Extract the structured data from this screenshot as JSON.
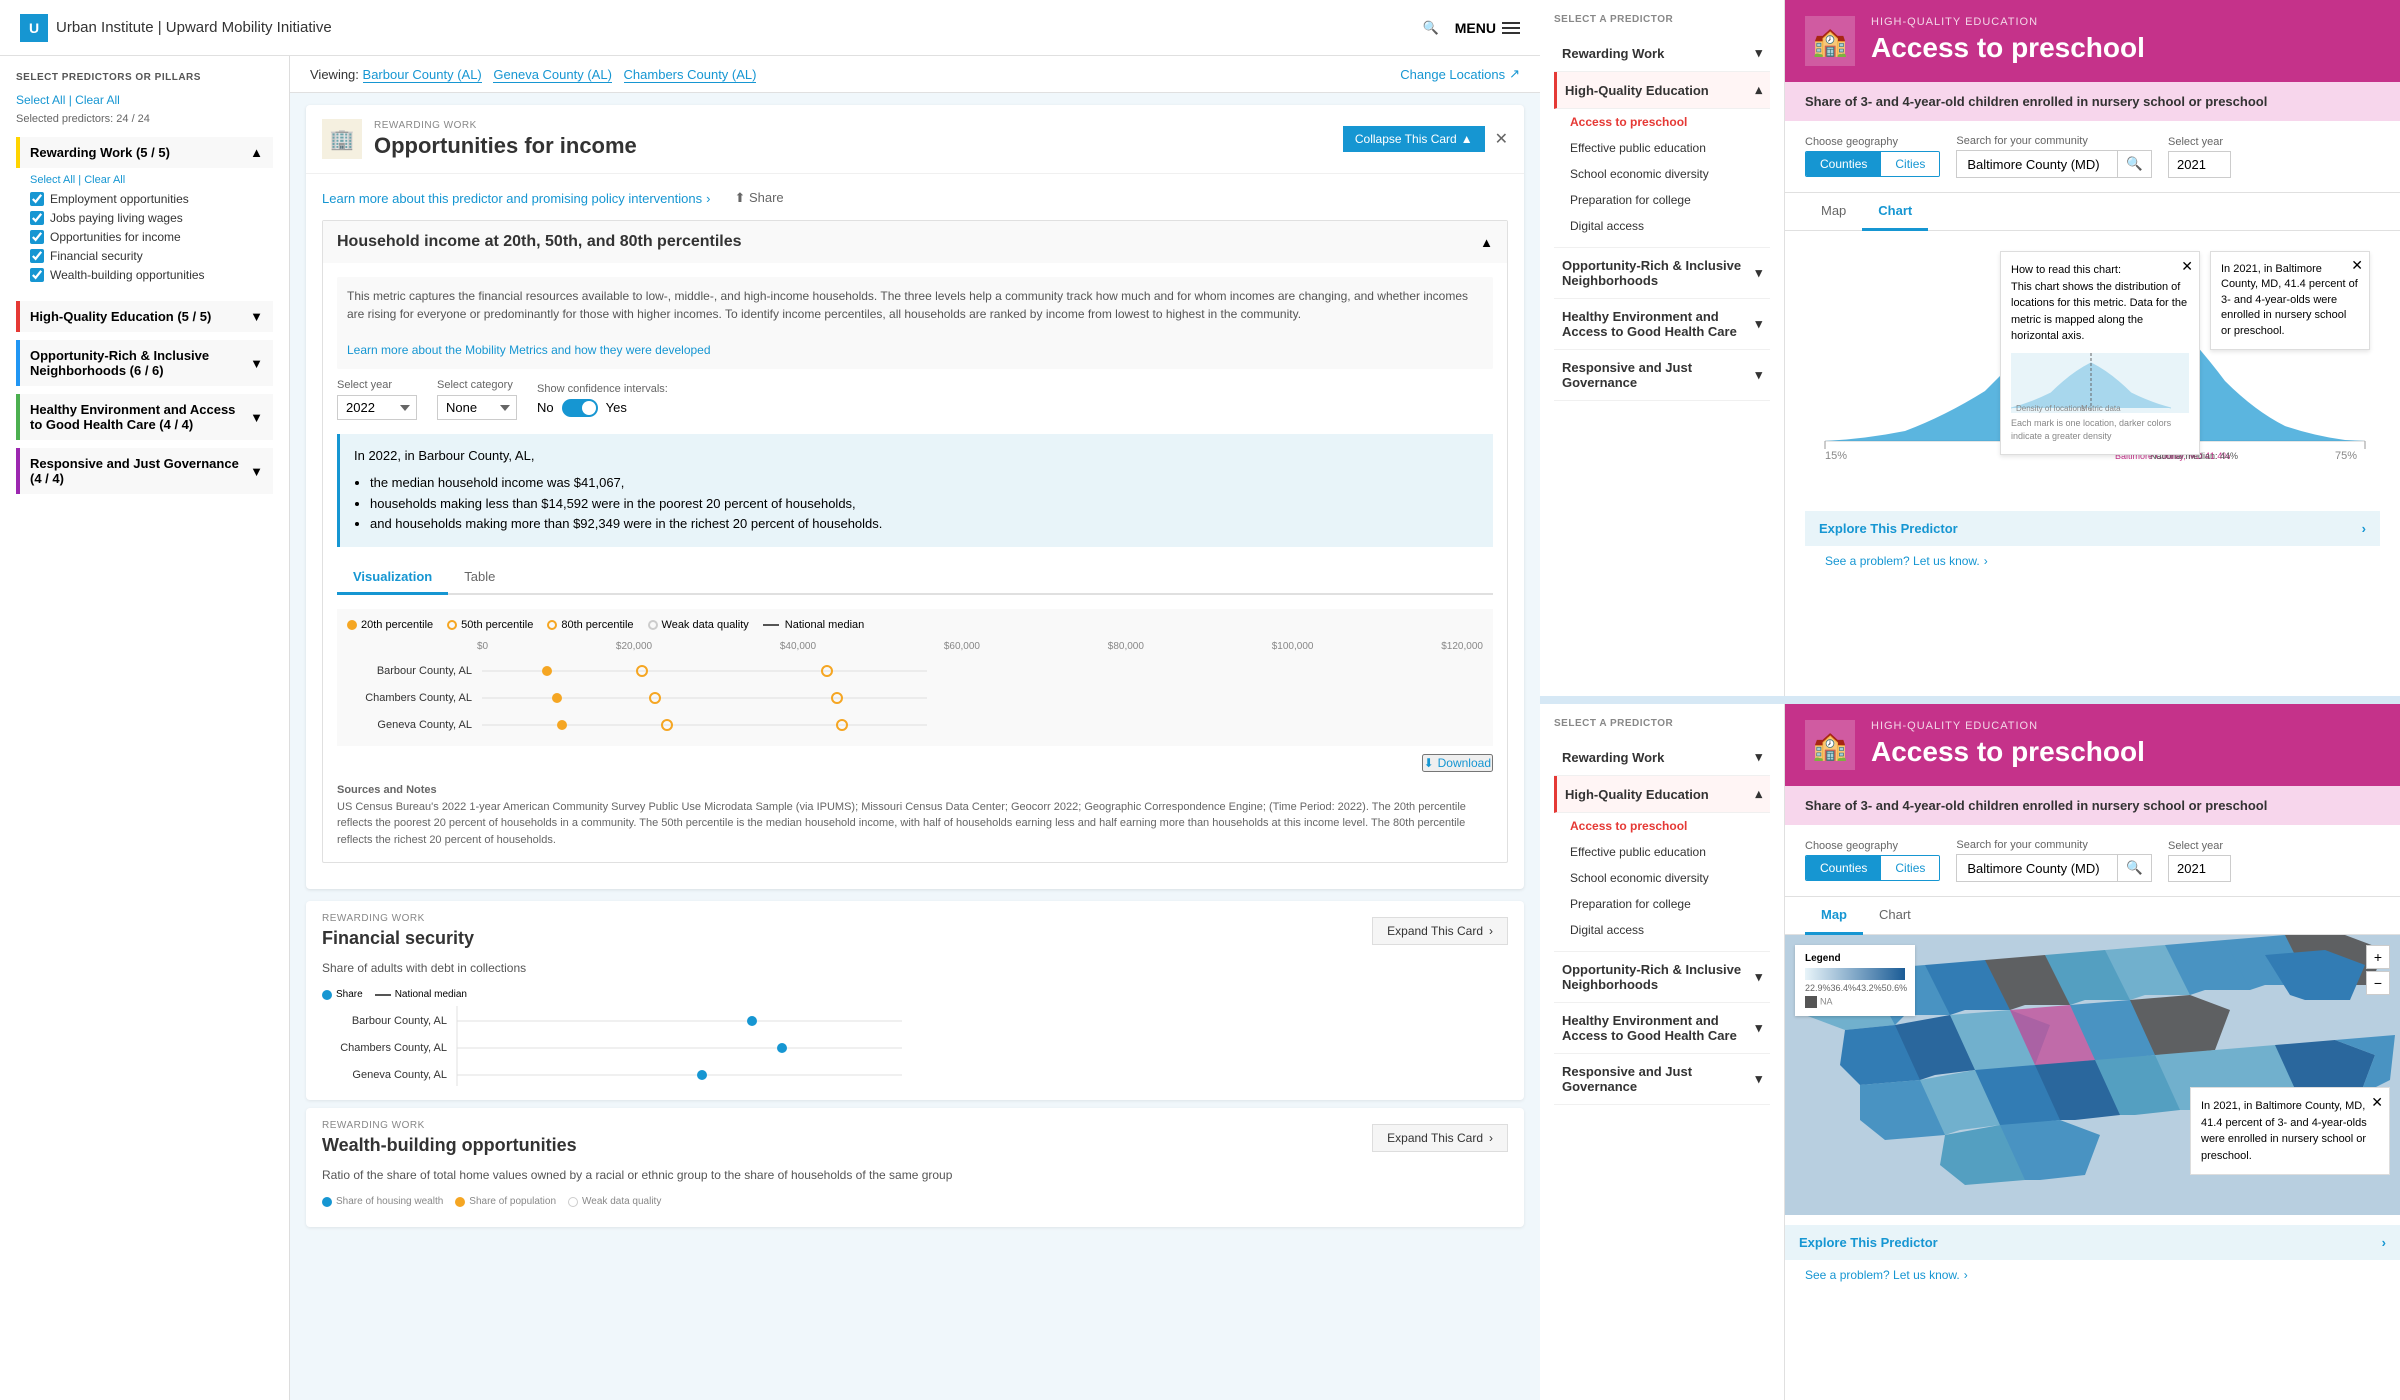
{
  "header": {
    "logo_letter": "U",
    "title": "Urban Institute | Upward Mobility Initiative",
    "menu_label": "MENU"
  },
  "sidebar": {
    "section_title": "SELECT PREDICTORS OR PILLARS",
    "select_all": "Select All",
    "clear_all": "Clear All",
    "selected_count": "Selected predictors: 24 / 24",
    "pillars": [
      {
        "name": "Rewarding Work",
        "count": "5 / 5",
        "color_class": "rewarding",
        "items": [
          "Employment opportunities",
          "Jobs paying living wages",
          "Opportunities for income",
          "Financial security",
          "Wealth-building opportunities"
        ]
      },
      {
        "name": "High-Quality Education",
        "count": "5 / 5",
        "color_class": "education",
        "items": [
          "Access to preschool",
          "Effective public education",
          "School economic diversity",
          "Preparation for college",
          "Digital access"
        ]
      },
      {
        "name": "Opportunity-Rich & Inclusive Neighborhoods",
        "count": "6 / 6",
        "color_class": "neighborhoods",
        "items": []
      },
      {
        "name": "Healthy Environment and Access to Good Health Care",
        "count": "4 / 4",
        "color_class": "health",
        "items": []
      },
      {
        "name": "Responsive and Just Governance",
        "count": "4 / 4",
        "color_class": "governance",
        "items": []
      }
    ]
  },
  "viewing": {
    "label": "Viewing:",
    "counties": [
      "Barbour County (AL)",
      "Geneva County (AL)",
      "Chambers County (AL)"
    ],
    "change_locations": "Change Locations"
  },
  "main_card": {
    "tag": "REWARDING WORK",
    "title": "Opportunities for income",
    "collapse_label": "Collapse This Card",
    "learn_more": "Learn more about this predictor and promising policy interventions",
    "share_label": "Share"
  },
  "sub_metric": {
    "title": "Household income at 20th, 50th, and 80th percentiles",
    "description": "This metric captures the financial resources available to low-, middle-, and high-income households. The three levels help a community track how much and for whom incomes are changing, and whether incomes are rising for everyone or predominantly for those with higher incomes. To identify income percentiles, all households are ranked by income from lowest to highest in the community.",
    "learn_more_link": "Learn more about the Mobility Metrics and how they were developed",
    "year_label": "Select year",
    "year_value": "2022",
    "category_label": "Select category",
    "category_value": "None",
    "confidence_label": "Show confidence intervals:",
    "toggle_no": "No",
    "toggle_yes": "Yes",
    "insight": "In 2022, in Barbour County, AL,\nthe median household income was $41,067,\nhouseholds making less than $14,592 were in the poorest 20 percent of households,\nand households making more than $92,349 were in the richest 20 percent of households.",
    "viz_tab_visualization": "Visualization",
    "viz_tab_table": "Table",
    "legend": [
      "20th percentile",
      "50th percentile",
      "80th percentile",
      "Weak data quality",
      "National median"
    ],
    "dot_rows": [
      {
        "label": "Barbour County, AL",
        "p20": 14,
        "p50": 41,
        "p80": 92
      },
      {
        "label": "Chambers County, AL",
        "p20": 15,
        "p50": 43,
        "p80": 95
      },
      {
        "label": "Geneva County, AL",
        "p20": 16,
        "p50": 45,
        "p80": 100
      }
    ],
    "axis_labels": [
      "$0",
      "$20,000",
      "$40,000",
      "$60,000",
      "$80,000",
      "$100,000",
      "$120,000"
    ],
    "download_label": "Download"
  },
  "sources": {
    "title": "Sources and Notes",
    "text": "US Census Bureau's 2022 1-year American Community Survey Public Use Microdata Sample (via IPUMS); Missouri Census Data Center; Geocorr 2022; Geographic Correspondence Engine; (Time Period: 2022). The 20th percentile reflects the poorest 20 percent of households in a community. The 50th percentile is the median household income, with half of households earning less and half earning more than households at this income level. The 80th percentile reflects the richest 20 percent of households."
  },
  "collapsed_cards": [
    {
      "tag": "REWARDING WORK",
      "title": "Financial security",
      "subtitle": "Share of adults with debt in collections",
      "expand_label": "Expand This Card"
    },
    {
      "tag": "REWARDING WORK",
      "title": "Wealth-building opportunities",
      "subtitle": "Ratio of the share of total home values owned by a racial or ethnic group to the share of households of the same group",
      "expand_label": "Expand This Card"
    }
  ],
  "right_panels": [
    {
      "id": "top",
      "selector_title": "SELECT A PREDICTOR",
      "predictors": [
        {
          "name": "Rewarding Work",
          "active": false
        },
        {
          "name": "High-Quality Education",
          "active": true
        },
        {
          "name": "Opportunity-Rich & Inclusive Neighborhoods",
          "active": false
        },
        {
          "name": "Healthy Environment and Access to Good Health Care",
          "active": false
        },
        {
          "name": "Responsive and Just Governance",
          "active": false
        }
      ],
      "sub_predictors": [
        {
          "name": "Access to preschool",
          "active": true
        },
        {
          "name": "Effective public education",
          "active": false
        },
        {
          "name": "School economic diversity",
          "active": false
        },
        {
          "name": "Preparation for college",
          "active": false
        },
        {
          "name": "Digital access",
          "active": false
        }
      ],
      "detail": {
        "category": "HIGH-QUALITY EDUCATION",
        "title": "Access to preschool",
        "subtitle": "Share of 3- and 4-year-old children enrolled in nursery school or preschool",
        "geo_options": [
          "Counties",
          "Cities"
        ],
        "active_geo": "Counties",
        "search_placeholder": "Baltimore County (MD)",
        "year": "2021",
        "active_tab": "Chart",
        "chart_how_to": "How to read this chart: This chart shows the distribution of locations for this metric. Data for the metric is mapped along the horizontal axis.",
        "chart_insight": "In 2021, in Baltimore County, MD, 41.4 percent of 3- and 4-year-olds were enrolled in nursery school or preschool.",
        "explore_label": "Explore This Predictor",
        "see_problem": "See a problem? Let us know.",
        "x_start": "15%",
        "x_end": "75%",
        "national_median": "44%",
        "location_value": "41.4%"
      }
    },
    {
      "id": "bottom",
      "selector_title": "SELECT A PREDICTOR",
      "predictors": [
        {
          "name": "Rewarding Work",
          "active": false
        },
        {
          "name": "High-Quality Education",
          "active": true
        },
        {
          "name": "Opportunity-Rich & Inclusive Neighborhoods",
          "active": false
        },
        {
          "name": "Healthy Environment and Access to Good Health Care",
          "active": false
        },
        {
          "name": "Responsive and Just Governance",
          "active": false
        }
      ],
      "sub_predictors": [
        {
          "name": "Access to preschool",
          "active": true
        },
        {
          "name": "Effective public education",
          "active": false
        },
        {
          "name": "School economic diversity",
          "active": false
        },
        {
          "name": "Preparation for college",
          "active": false
        },
        {
          "name": "Digital access",
          "active": false
        }
      ],
      "detail": {
        "category": "HIGH-QUALITY EDUCATION",
        "title": "Access to preschool",
        "subtitle": "Share of 3- and 4-year-old children enrolled in nursery school or preschool",
        "geo_options": [
          "Counties",
          "Cities"
        ],
        "active_geo": "Counties",
        "search_placeholder": "Baltimore County (MD)",
        "year": "2021",
        "active_tab": "Map",
        "map_insight": "In 2021, in Baltimore County, MD, 41.4 percent of 3- and 4-year-olds were enrolled in nursery school or preschool.",
        "explore_label": "Explore This Predictor",
        "map_legend_values": [
          "22.9%",
          "36.4%",
          "43.2%",
          "50.6%",
          "NA"
        ],
        "see_problem": "See a problem? Let us know."
      }
    }
  ]
}
